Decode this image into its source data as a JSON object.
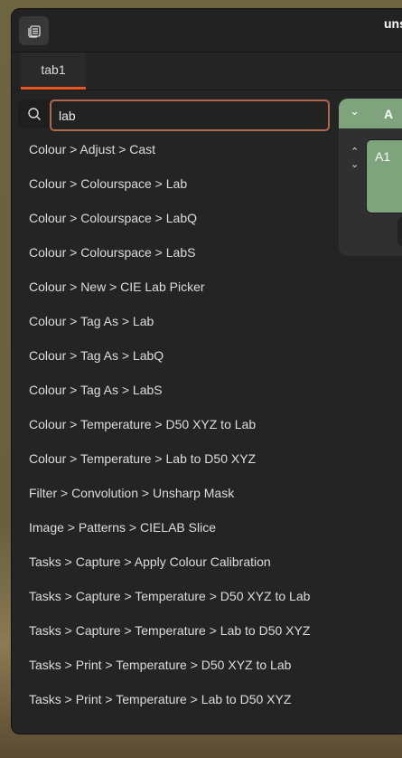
{
  "window": {
    "title": "uns"
  },
  "tabs": [
    {
      "label": "tab1"
    }
  ],
  "search": {
    "value": "lab"
  },
  "results": [
    "Colour > Adjust > Cast",
    "Colour > Colourspace > Lab",
    "Colour > Colourspace > LabQ",
    "Colour > Colourspace > LabS",
    "Colour > New > CIE Lab Picker",
    "Colour > Tag As > Lab",
    "Colour > Tag As > LabQ",
    "Colour > Tag As > LabS",
    "Colour > Temperature > D50 XYZ to Lab",
    "Colour > Temperature > Lab to D50 XYZ",
    "Filter > Convolution > Unsharp Mask",
    "Image > Patterns > CIELAB Slice",
    "Tasks > Capture > Apply Colour Calibration",
    "Tasks > Capture > Temperature > D50 XYZ to Lab",
    "Tasks > Capture > Temperature > Lab to D50 XYZ",
    "Tasks > Print > Temperature > D50 XYZ to Lab",
    "Tasks > Print > Temperature > Lab to D50 XYZ"
  ],
  "workspace": {
    "column_label": "A",
    "cell_label": "A1"
  }
}
